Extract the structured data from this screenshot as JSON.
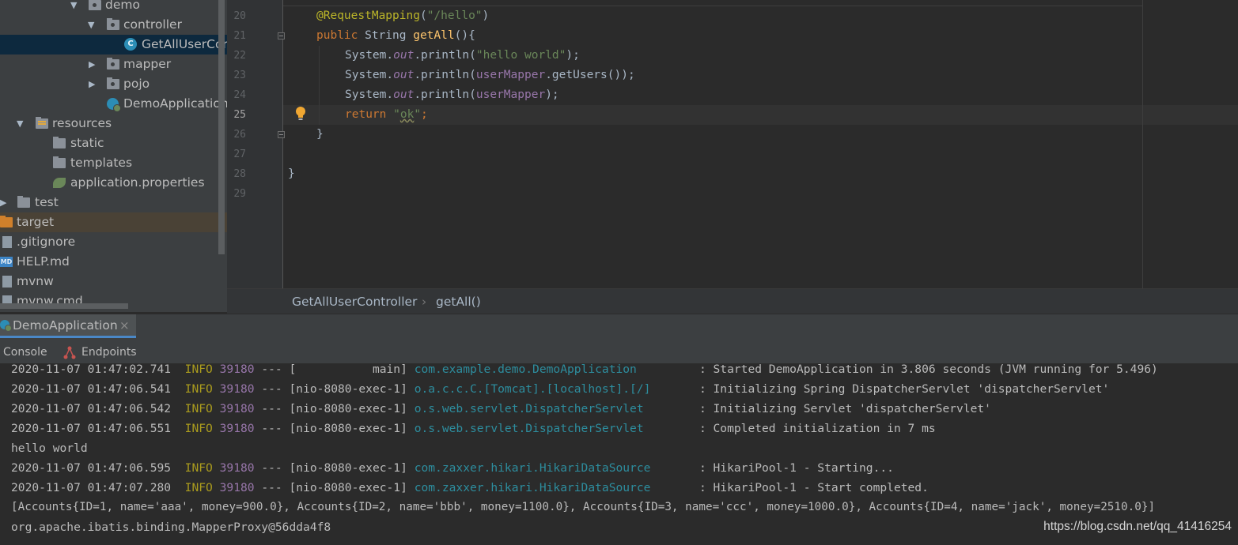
{
  "project_tree": {
    "items": [
      {
        "label": "demo",
        "arrow": "▼",
        "icon": "package-folder-icon"
      },
      {
        "label": "controller",
        "arrow": "▼",
        "icon": "package-folder-icon"
      },
      {
        "label": "GetAllUserCon",
        "arrow": "",
        "icon": "java-class-icon",
        "icon_text": "C"
      },
      {
        "label": "mapper",
        "arrow": "▶",
        "icon": "package-folder-icon"
      },
      {
        "label": "pojo",
        "arrow": "▶",
        "icon": "package-folder-icon"
      },
      {
        "label": "DemoApplication",
        "arrow": "",
        "icon": "spring-boot-app-icon"
      },
      {
        "label": "resources",
        "arrow": "▼",
        "icon": "resources-folder-icon"
      },
      {
        "label": "static",
        "arrow": "",
        "icon": "folder-icon"
      },
      {
        "label": "templates",
        "arrow": "",
        "icon": "folder-icon"
      },
      {
        "label": "application.properties",
        "arrow": "",
        "icon": "spring-properties-icon"
      },
      {
        "label": "test",
        "arrow": "▶",
        "icon": "folder-icon"
      },
      {
        "label": "target",
        "arrow": "",
        "icon": "excluded-folder-icon"
      },
      {
        "label": ".gitignore",
        "arrow": "",
        "icon": "file-icon"
      },
      {
        "label": "HELP.md",
        "arrow": "",
        "icon": "markdown-file-icon",
        "icon_text": "MD"
      },
      {
        "label": "mvnw",
        "arrow": "",
        "icon": "file-icon"
      },
      {
        "label": "mvnw.cmd",
        "arrow": "",
        "icon": "file-icon"
      }
    ]
  },
  "editor": {
    "line_numbers": [
      "20",
      "21",
      "22",
      "23",
      "24",
      "25",
      "26",
      "27",
      "28",
      "29"
    ],
    "current_line": "25",
    "lines": {
      "l20": {
        "t1": "@RequestMapping",
        "t2": "(",
        "t3": "\"/hello\"",
        "t4": ")"
      },
      "l21": {
        "t1": "public ",
        "t2": "String ",
        "t3": "getAll",
        "t4": "(){"
      },
      "l22": {
        "t1": "System.",
        "t2": "out",
        "t3": ".println(",
        "t4": "\"hello world\"",
        "t5": ");"
      },
      "l23": {
        "t1": "System.",
        "t2": "out",
        "t3": ".println(",
        "t4": "userMapper",
        "t5": ".getUsers());"
      },
      "l24": {
        "t1": "System.",
        "t2": "out",
        "t3": ".println(",
        "t4": "userMapper",
        "t5": ");"
      },
      "l25": {
        "t1": "return ",
        "t2": "\"",
        "t3": "ok",
        "t4": "\"",
        "t5": ";"
      },
      "l26": {
        "t1": "}"
      },
      "l28": {
        "t1": "}"
      }
    }
  },
  "breadcrumb": {
    "class_name": "GetAllUserController",
    "separator": "›",
    "method": "getAll()"
  },
  "run_panel": {
    "tab_label": "DemoApplication",
    "close_glyph": "×",
    "subtabs": {
      "console": "Console",
      "endpoints": "Endpoints"
    }
  },
  "console": {
    "lines": [
      {
        "ts": "2020-11-07 01:47:02.741",
        "level": "INFO",
        "pid": "39180",
        "sep": "---",
        "thread": "[           main]",
        "logger": "com.example.demo.DemoApplication        ",
        "msg": ": Started DemoApplication in 3.806 seconds (JVM running for 5.496)"
      },
      {
        "ts": "2020-11-07 01:47:06.541",
        "level": "INFO",
        "pid": "39180",
        "sep": "---",
        "thread": "[nio-8080-exec-1]",
        "logger": "o.a.c.c.C.[Tomcat].[localhost].[/]      ",
        "msg": ": Initializing Spring DispatcherServlet 'dispatcherServlet'"
      },
      {
        "ts": "2020-11-07 01:47:06.542",
        "level": "INFO",
        "pid": "39180",
        "sep": "---",
        "thread": "[nio-8080-exec-1]",
        "logger": "o.s.web.servlet.DispatcherServlet       ",
        "msg": ": Initializing Servlet 'dispatcherServlet'"
      },
      {
        "ts": "2020-11-07 01:47:06.551",
        "level": "INFO",
        "pid": "39180",
        "sep": "---",
        "thread": "[nio-8080-exec-1]",
        "logger": "o.s.web.servlet.DispatcherServlet       ",
        "msg": ": Completed initialization in 7 ms"
      },
      {
        "plain": "hello world"
      },
      {
        "ts": "2020-11-07 01:47:06.595",
        "level": "INFO",
        "pid": "39180",
        "sep": "---",
        "thread": "[nio-8080-exec-1]",
        "logger": "com.zaxxer.hikari.HikariDataSource      ",
        "msg": ": HikariPool-1 - Starting..."
      },
      {
        "ts": "2020-11-07 01:47:07.280",
        "level": "INFO",
        "pid": "39180",
        "sep": "---",
        "thread": "[nio-8080-exec-1]",
        "logger": "com.zaxxer.hikari.HikariDataSource      ",
        "msg": ": HikariPool-1 - Start completed."
      },
      {
        "plain": "[Accounts{ID=1, name='aaa', money=900.0}, Accounts{ID=2, name='bbb', money=1100.0}, Accounts{ID=3, name='ccc', money=1000.0}, Accounts{ID=4, name='jack', money=2510.0}]"
      },
      {
        "plain": "org.apache.ibatis.binding.MapperProxy@56dda4f8"
      }
    ]
  },
  "watermark": "https://blog.csdn.net/qq_41416254",
  "colors": {
    "keyword": "#cc7832",
    "string": "#6a8759",
    "annotation": "#bbb529",
    "function": "#ffc66d",
    "static_field": "#9876aa",
    "log_info": "#ab9c1e",
    "logger": "#2d8d9e"
  }
}
